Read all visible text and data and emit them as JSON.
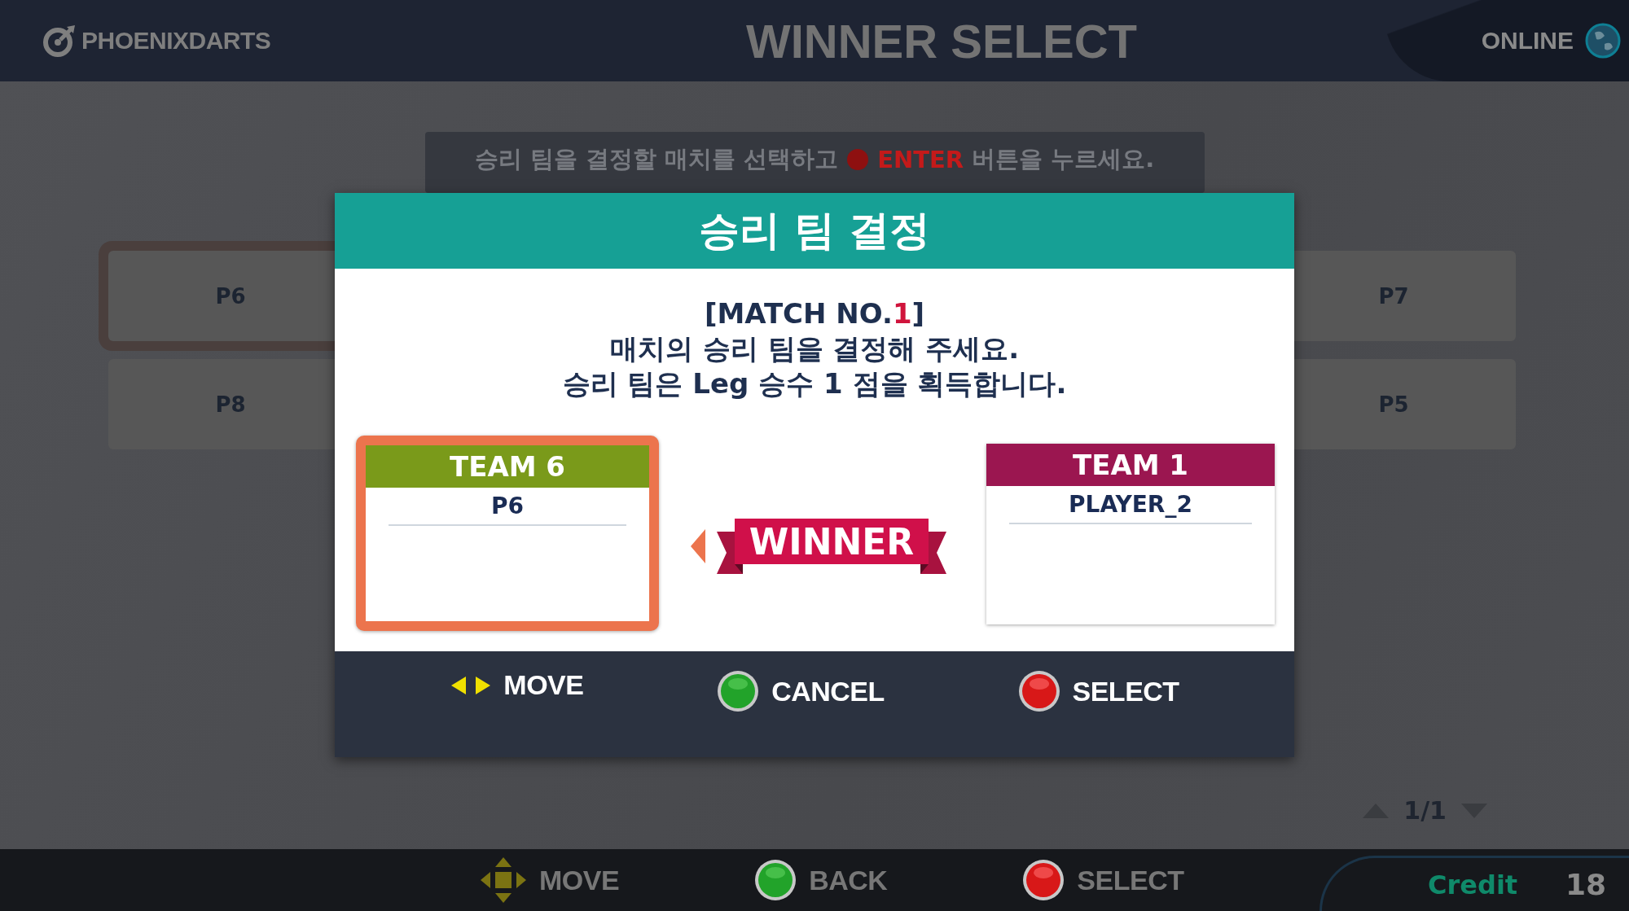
{
  "header": {
    "logo": "PHOENIXDARTS",
    "title": "WINNER SELECT",
    "status": "ONLINE"
  },
  "instruction": {
    "before": "승리 팀을 결정할 매치를 선택하고",
    "key": "ENTER",
    "after": "버튼을 누르세요."
  },
  "left_cards": [
    {
      "label": "P6",
      "selected": true
    },
    {
      "label": "P8",
      "selected": false
    }
  ],
  "right_cards": [
    {
      "label": "P7",
      "selected": false
    },
    {
      "label": "P5",
      "selected": false
    }
  ],
  "dialog": {
    "title": "승리 팀 결정",
    "match_prefix": "[MATCH NO.",
    "match_number": "1",
    "match_suffix": "]",
    "lines": [
      "매치의 승리 팀을 결정해 주세요.",
      "승리 팀은 Leg 승수 1 점을 획득합니다."
    ],
    "teams": [
      {
        "name": "TEAM 6",
        "player": "P6",
        "color": "#7a9a1a",
        "selected": true
      },
      {
        "name": "TEAM 1",
        "player": "PLAYER_2",
        "color": "#9b1650",
        "selected": false
      }
    ],
    "banner": "WINNER",
    "hints": [
      {
        "kind": "arrows",
        "label": "MOVE"
      },
      {
        "kind": "green",
        "label": "CANCEL"
      },
      {
        "kind": "red",
        "label": "SELECT"
      }
    ]
  },
  "pager": "1/1",
  "footer": {
    "hints": [
      {
        "kind": "dpad",
        "label": "MOVE"
      },
      {
        "kind": "green",
        "label": "BACK"
      },
      {
        "kind": "red",
        "label": "SELECT"
      }
    ],
    "credit_label": "Credit",
    "credit_value": "18"
  }
}
